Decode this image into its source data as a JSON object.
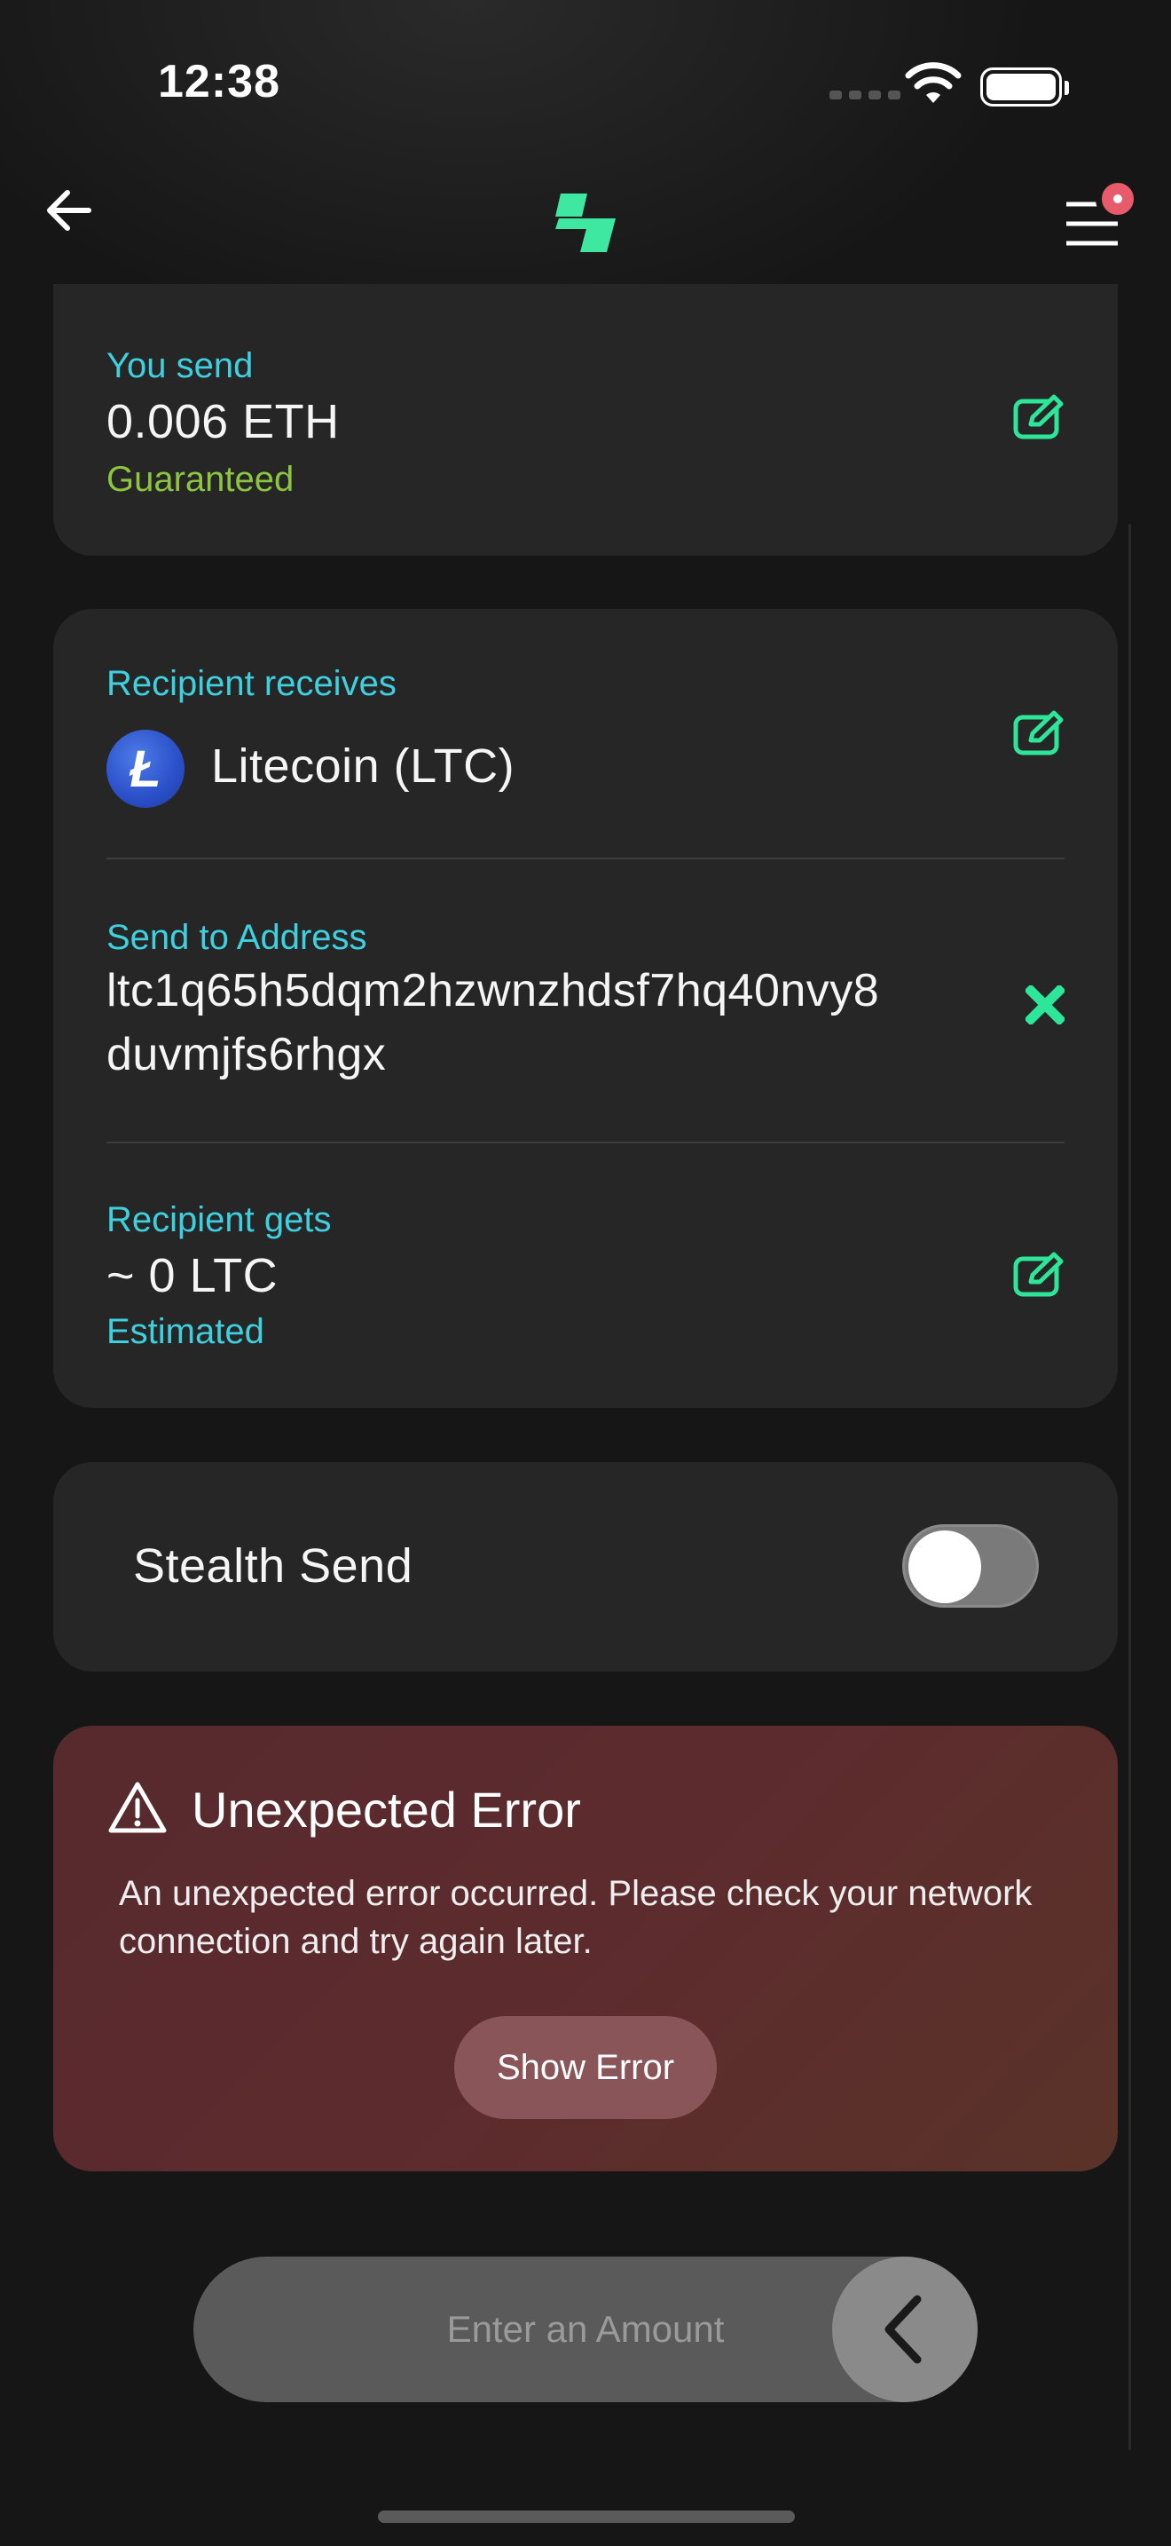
{
  "status_bar": {
    "time": "12:38"
  },
  "nav": {
    "back": "back-arrow",
    "logo": "app-logo",
    "menu": "menu",
    "menu_badge": "notification-dot"
  },
  "send_card": {
    "label": "You send",
    "amount": "0.006 ETH",
    "note": "Guaranteed"
  },
  "receive_card": {
    "receives_label": "Recipient receives",
    "coin_name": "Litecoin (LTC)",
    "coin_symbol_glyph": "Ł",
    "address_label": "Send to Address",
    "address_line1": "ltc1q65h5dqm2hzwnzhdsf7hq40nvy8",
    "address_line2": "duvmjfs6rhgx",
    "gets_label": "Recipient gets",
    "gets_amount": "~ 0 LTC",
    "gets_note": "Estimated"
  },
  "stealth": {
    "label": "Stealth Send",
    "enabled": false
  },
  "error": {
    "title": "Unexpected Error",
    "message": "An unexpected error occurred. Please check your network connection and try again later.",
    "button": "Show Error"
  },
  "amount_bar": {
    "placeholder": "Enter an Amount"
  },
  "colors": {
    "accent_green": "#2ee69a",
    "label_cyan": "#3fd0e0",
    "guaranteed_green": "#8cc63f",
    "error_bg": "#5a2b2e"
  }
}
